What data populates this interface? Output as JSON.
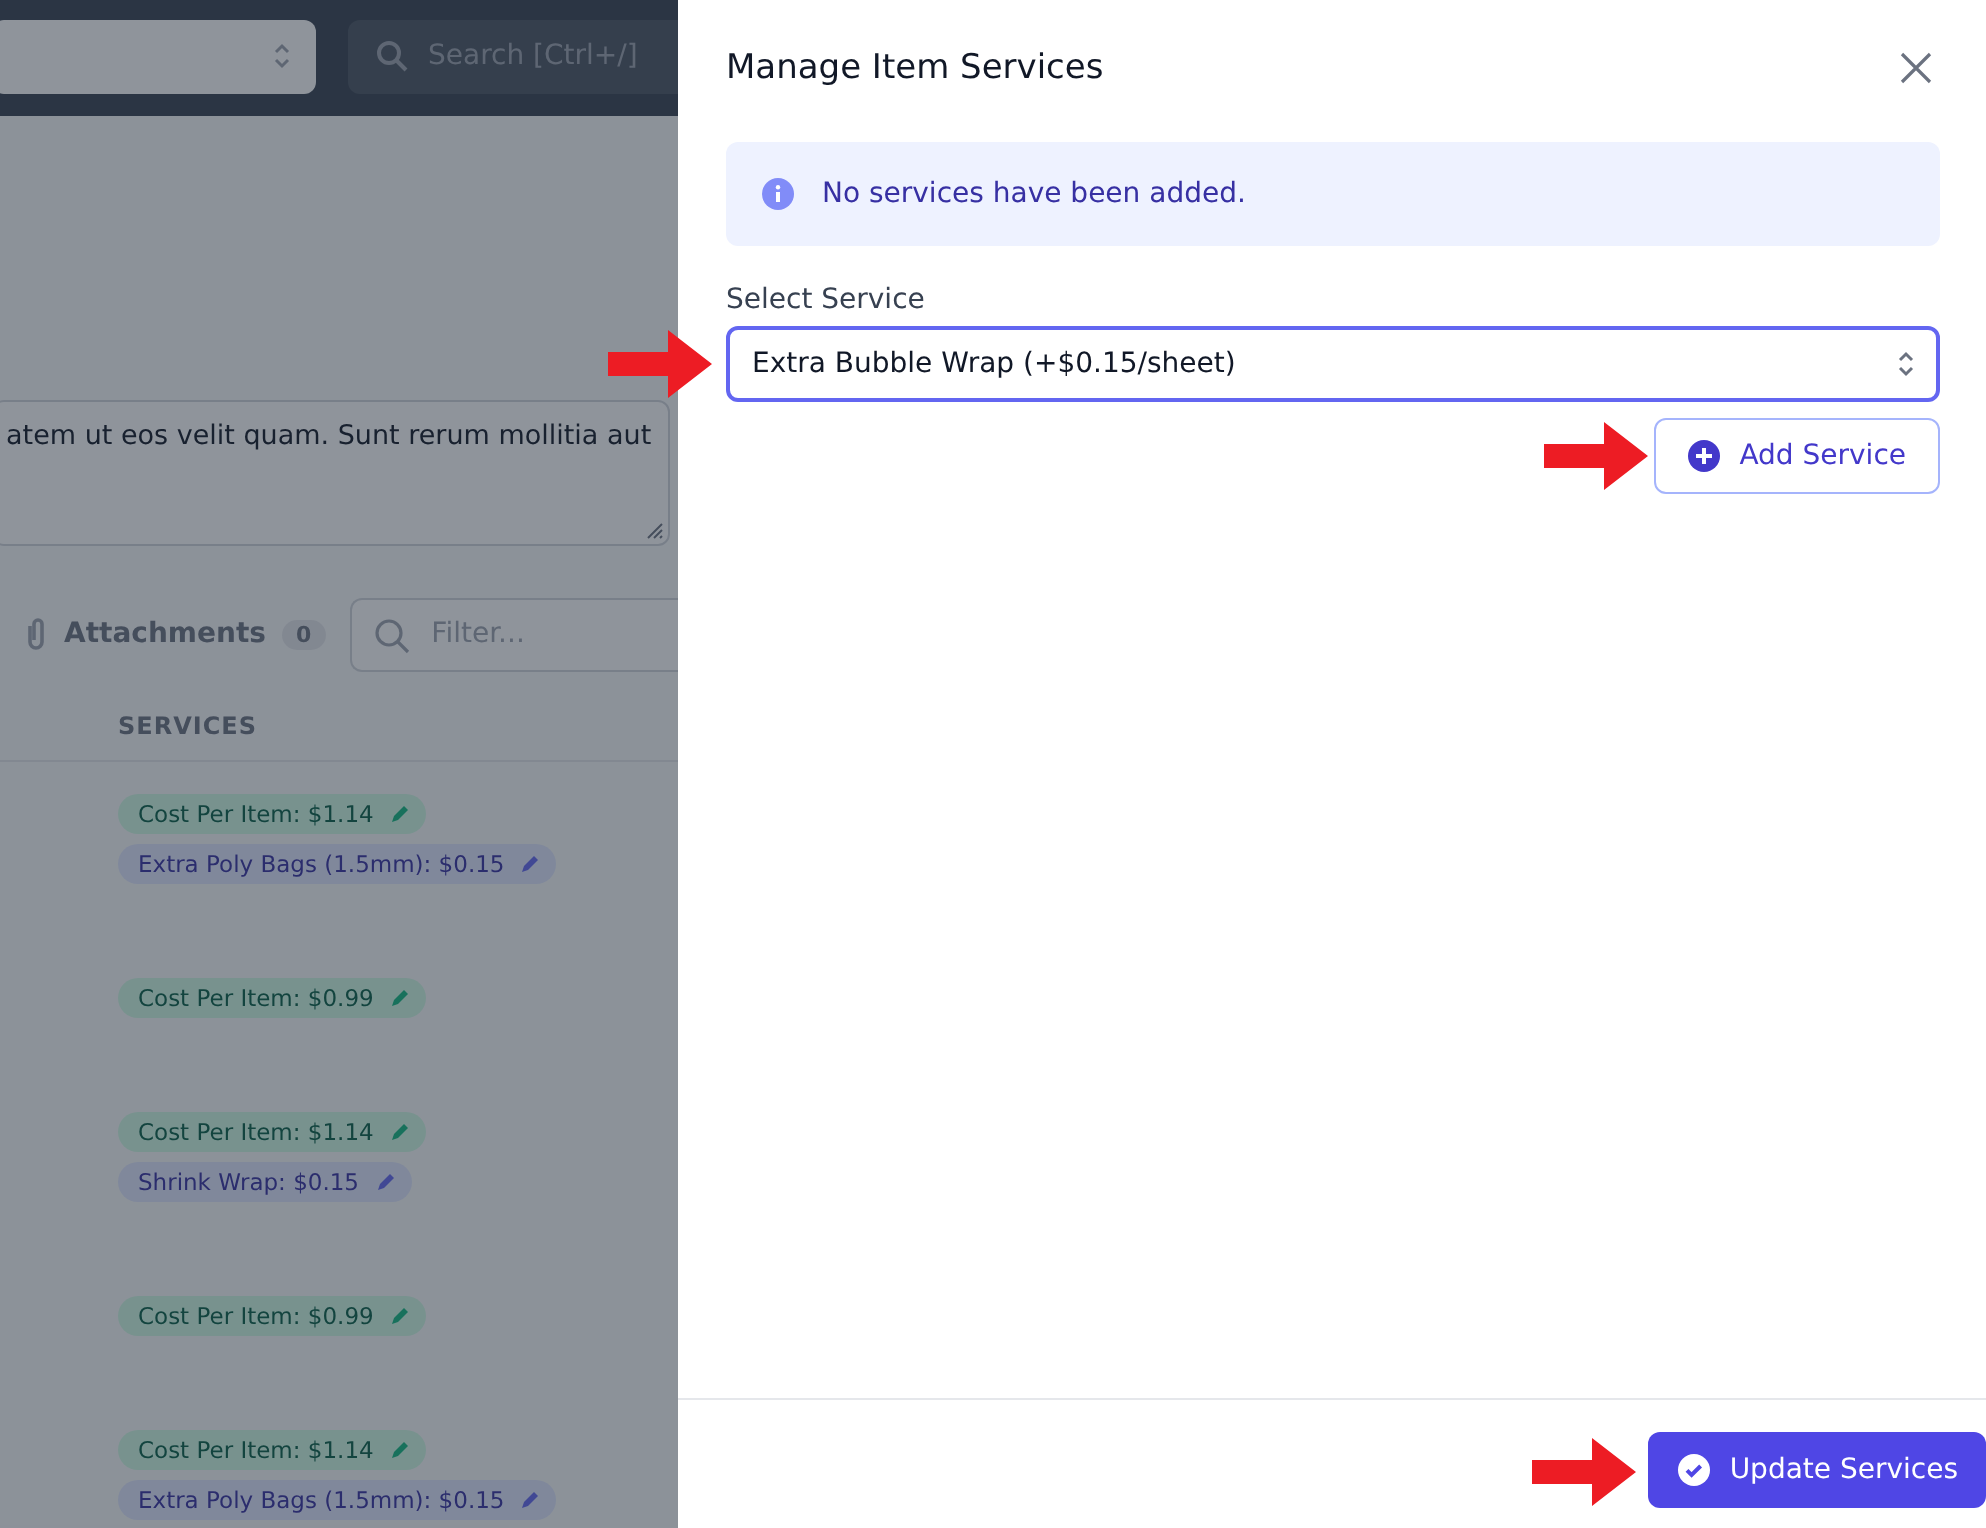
{
  "background": {
    "search": {
      "placeholder": "Search [Ctrl+/]"
    },
    "notes": {
      "value": "atem ut eos velit quam. Sunt rerum mollitia aut"
    },
    "tabs": [
      {
        "label": "Attachments",
        "count": "0"
      }
    ],
    "filter": {
      "placeholder": "Filter..."
    },
    "table": {
      "columns": [
        "SERVICES"
      ],
      "rows": [
        {
          "tags": [
            {
              "kind": "cost",
              "label": "Cost Per Item: $1.14"
            },
            {
              "kind": "service",
              "label": "Extra Poly Bags (1.5mm): $0.15"
            }
          ]
        },
        {
          "tags": [
            {
              "kind": "cost",
              "label": "Cost Per Item: $0.99"
            }
          ]
        },
        {
          "tags": [
            {
              "kind": "cost",
              "label": "Cost Per Item: $1.14"
            },
            {
              "kind": "service",
              "label": "Shrink Wrap: $0.15"
            }
          ]
        },
        {
          "tags": [
            {
              "kind": "cost",
              "label": "Cost Per Item: $0.99"
            }
          ]
        },
        {
          "tags": [
            {
              "kind": "cost",
              "label": "Cost Per Item: $1.14"
            },
            {
              "kind": "service",
              "label": "Extra Poly Bags (1.5mm): $0.15"
            }
          ]
        }
      ]
    }
  },
  "panel": {
    "title": "Manage Item Services",
    "alert": "No services have been added.",
    "select": {
      "label": "Select Service",
      "value": "Extra Bubble Wrap (+$0.15/sheet)"
    },
    "add_button": "Add Service",
    "submit_button": "Update Services"
  }
}
